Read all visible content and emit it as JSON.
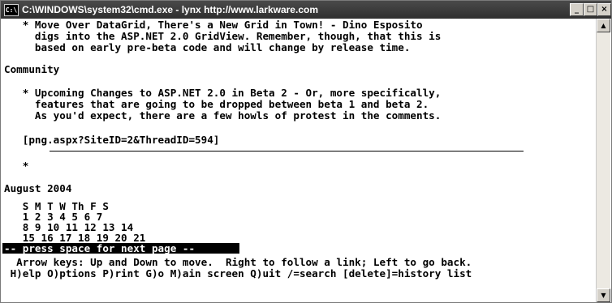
{
  "window": {
    "title": "C:\\WINDOWS\\system32\\cmd.exe - lynx http://www.larkware.com",
    "icon": "cmd-icon",
    "controls": [
      "_",
      "□",
      "×"
    ]
  },
  "content": {
    "lines": [
      "   * Move Over DataGrid, There's a New Grid in Town! - Dino Esposito",
      "     digs into the ASP.NET 2.0 GridView. Remember, though, that this is",
      "     based on early pre-beta code and will change by release time.",
      "Community",
      "   * Upcoming Changes to ASP.NET 2.0 in Beta 2 - Or, more specifically,",
      "     features that are going to be dropped between beta 1 and beta 2.",
      "     As you'd expect, there are a few howls of protest in the comments.",
      "   [png.aspx?SiteID=2&ThreadID=594]",
      "   *",
      "August 2004",
      "   S M T W Th F S",
      "   1 2 3 4 5 6 7",
      "   8 9 10 11 12 13 14",
      "   15 16 17 18 19 20 21"
    ],
    "status_prompt": "-- press space for next page --",
    "help_lines": [
      "  Arrow keys: Up and Down to move.  Right to follow a link; Left to go back.",
      " H)elp O)ptions P)rint G)o M)ain screen Q)uit /=search [delete]=history list"
    ]
  },
  "scrollbar": {
    "up_arrow": "▲",
    "down_arrow": "▼"
  }
}
